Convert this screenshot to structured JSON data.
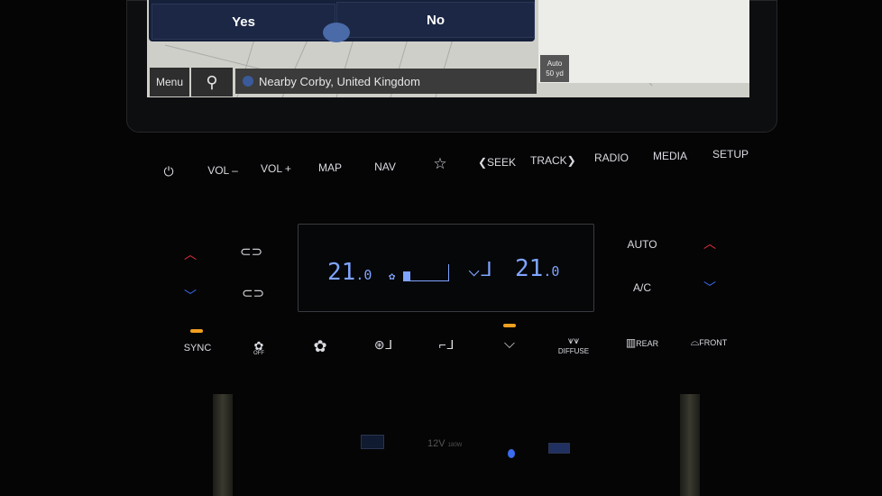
{
  "screen": {
    "dialog": {
      "yes_label": "Yes",
      "no_label": "No"
    },
    "menu_label": "Menu",
    "search_icon": "search-icon",
    "location_text": "Nearby Corby, United Kingdom",
    "scale": {
      "mode": "Auto",
      "distance": "50 yd"
    }
  },
  "hardkeys": [
    {
      "id": "power",
      "label": "⏻"
    },
    {
      "id": "vol-down",
      "label": "VOL –"
    },
    {
      "id": "vol-up",
      "label": "VOL +"
    },
    {
      "id": "map",
      "label": "MAP"
    },
    {
      "id": "nav",
      "label": "NAV"
    },
    {
      "id": "favorite",
      "label": "☆"
    },
    {
      "id": "seek",
      "label": "❮SEEK"
    },
    {
      "id": "track",
      "label": "TRACK❯"
    },
    {
      "id": "radio",
      "label": "RADIO"
    },
    {
      "id": "media",
      "label": "MEDIA"
    },
    {
      "id": "setup",
      "label": "SETUP"
    }
  ],
  "climate": {
    "driver_temp": "21",
    "driver_temp_dec": ".0",
    "passenger_temp": "21",
    "passenger_temp_dec": ".0",
    "fan_level_fraction": 0.15,
    "auto_label": "AUTO",
    "ac_label": "A/C",
    "bottom": [
      {
        "id": "sync",
        "label": "SYNC",
        "active": true
      },
      {
        "id": "fan-off",
        "label": "OFF",
        "active": false
      },
      {
        "id": "fan",
        "label": "",
        "active": false
      },
      {
        "id": "mode-defrost-face",
        "label": "",
        "active": false
      },
      {
        "id": "mode-face",
        "label": "",
        "active": false
      },
      {
        "id": "mode-feet",
        "label": "",
        "active": true
      },
      {
        "id": "diffuse",
        "label": "DIFFUSE",
        "active": false
      },
      {
        "id": "rear-defrost",
        "label": "REAR",
        "active": false
      },
      {
        "id": "front-defrost",
        "label": "FRONT",
        "active": false
      }
    ],
    "accent_color": "#7fa4ff",
    "indicator_color": "#f0a020",
    "up_arrow_color": "#e0303a",
    "down_arrow_color": "#3a6cf0"
  },
  "console": {
    "socket_label": "12V",
    "socket_power": "180W"
  }
}
